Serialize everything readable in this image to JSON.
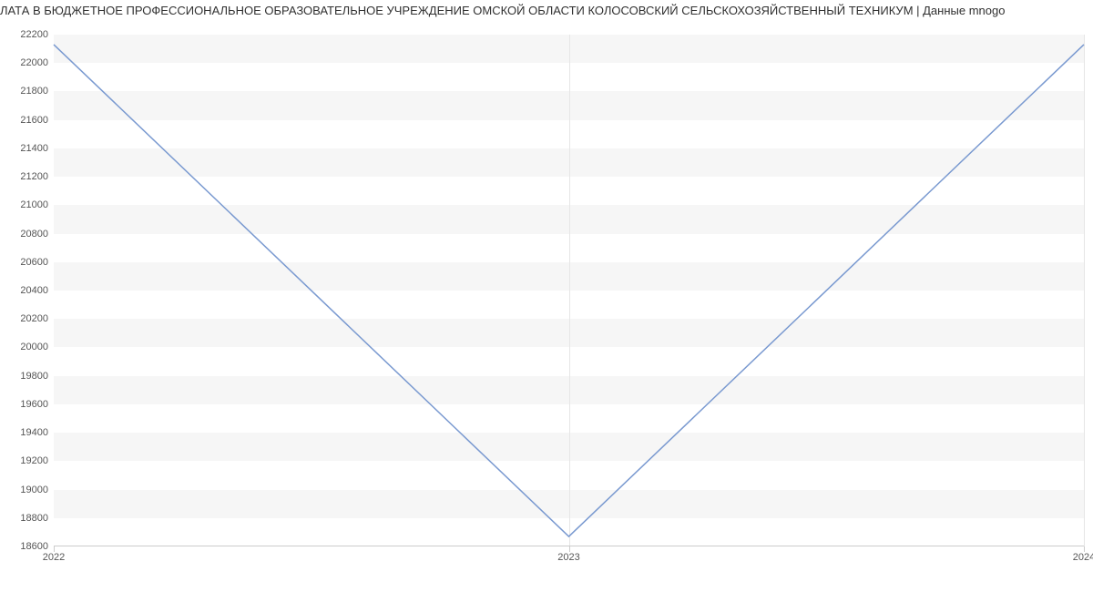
{
  "chart_data": {
    "type": "line",
    "title": "ЛАТА В БЮДЖЕТНОЕ ПРОФЕССИОНАЛЬНОЕ ОБРАЗОВАТЕЛЬНОЕ УЧРЕЖДЕНИЕ ОМСКОЙ ОБЛАСТИ КОЛОСОВСКИЙ СЕЛЬСКОХОЗЯЙСТВЕННЫЙ ТЕХНИКУМ | Данные mnogo",
    "x": [
      2022,
      2023,
      2024
    ],
    "values": [
      22130,
      18670,
      22130
    ],
    "x_ticks": [
      2022,
      2023,
      2024
    ],
    "y_ticks": [
      18600,
      18800,
      19000,
      19200,
      19400,
      19600,
      19800,
      20000,
      20200,
      20400,
      20600,
      20800,
      21000,
      21200,
      21400,
      21600,
      21800,
      22000,
      22200
    ],
    "xlabel": "",
    "ylabel": "",
    "ylim": [
      18600,
      22200
    ],
    "line_color": "#7999d0"
  }
}
